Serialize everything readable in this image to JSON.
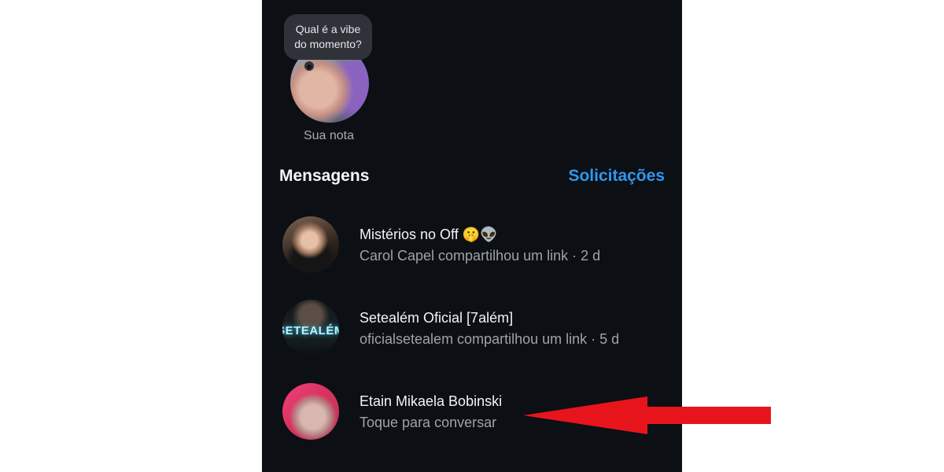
{
  "note": {
    "bubble_text": "Qual é a vibe\ndo momento?",
    "label": "Sua nota"
  },
  "messages_header": {
    "title": "Mensagens",
    "requests_link": "Solicitações"
  },
  "conversations": [
    {
      "name": "Mistérios no Off 🤫👽",
      "subtitle": "Carol Capel compartilhou um link · 2 d"
    },
    {
      "name": "Setealém Oficial [7além]",
      "subtitle": "oficialsetealem compartilhou um link · 5 d",
      "avatar_text": "SETEALÉM"
    },
    {
      "name": "Etain Mikaela Bobinski",
      "subtitle": "Toque para conversar"
    }
  ],
  "colors": {
    "background": "#0c0f14",
    "accent_link": "#2f96f0",
    "annotation_arrow": "#e8141c"
  }
}
